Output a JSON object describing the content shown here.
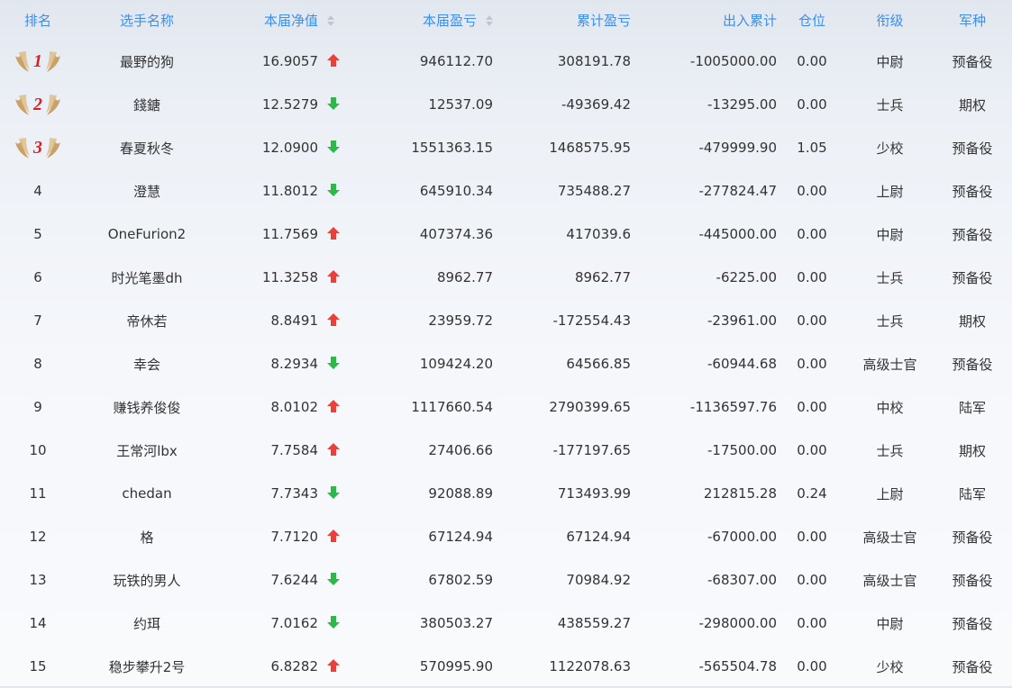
{
  "columns": {
    "rank": "排名",
    "name": "选手名称",
    "nav": "本届净值",
    "profit": "本届盈亏",
    "cumulative": "累计盈亏",
    "inout": "出入累计",
    "position": "仓位",
    "grade": "衔级",
    "branch": "军种"
  },
  "icons": {
    "sort": "sort-icon",
    "up": "arrow-up-icon",
    "down": "arrow-down-icon",
    "medal": "winged-medal-icon"
  },
  "colors": {
    "header_text": "#3d8ee6",
    "up": "#e8413a",
    "down": "#2fb84a",
    "medal_number": "#e21d1d",
    "wing": "#c9a26a"
  },
  "rows": [
    {
      "rank": "1",
      "name": "最野的狗",
      "nav": "16.9057",
      "trend": "up",
      "profit": "946112.70",
      "cumulative": "308191.78",
      "inout": "-1005000.00",
      "position": "0.00",
      "grade": "中尉",
      "branch": "预备役"
    },
    {
      "rank": "2",
      "name": "錢鎕",
      "nav": "12.5279",
      "trend": "down",
      "profit": "12537.09",
      "cumulative": "-49369.42",
      "inout": "-13295.00",
      "position": "0.00",
      "grade": "士兵",
      "branch": "期权"
    },
    {
      "rank": "3",
      "name": "春夏秋冬",
      "nav": "12.0900",
      "trend": "down",
      "profit": "1551363.15",
      "cumulative": "1468575.95",
      "inout": "-479999.90",
      "position": "1.05",
      "grade": "少校",
      "branch": "预备役"
    },
    {
      "rank": "4",
      "name": "澄慧",
      "nav": "11.8012",
      "trend": "down",
      "profit": "645910.34",
      "cumulative": "735488.27",
      "inout": "-277824.47",
      "position": "0.00",
      "grade": "上尉",
      "branch": "预备役"
    },
    {
      "rank": "5",
      "name": "OneFurion2",
      "nav": "11.7569",
      "trend": "up",
      "profit": "407374.36",
      "cumulative": "417039.6",
      "inout": "-445000.00",
      "position": "0.00",
      "grade": "中尉",
      "branch": "预备役"
    },
    {
      "rank": "6",
      "name": "时光笔墨dh",
      "nav": "11.3258",
      "trend": "up",
      "profit": "8962.77",
      "cumulative": "8962.77",
      "inout": "-6225.00",
      "position": "0.00",
      "grade": "士兵",
      "branch": "预备役"
    },
    {
      "rank": "7",
      "name": "帝休若",
      "nav": "8.8491",
      "trend": "up",
      "profit": "23959.72",
      "cumulative": "-172554.43",
      "inout": "-23961.00",
      "position": "0.00",
      "grade": "士兵",
      "branch": "期权"
    },
    {
      "rank": "8",
      "name": "幸会",
      "nav": "8.2934",
      "trend": "down",
      "profit": "109424.20",
      "cumulative": "64566.85",
      "inout": "-60944.68",
      "position": "0.00",
      "grade": "高级士官",
      "branch": "预备役"
    },
    {
      "rank": "9",
      "name": "赚钱养俊俊",
      "nav": "8.0102",
      "trend": "up",
      "profit": "1117660.54",
      "cumulative": "2790399.65",
      "inout": "-1136597.76",
      "position": "0.00",
      "grade": "中校",
      "branch": "陆军"
    },
    {
      "rank": "10",
      "name": "王常河lbx",
      "nav": "7.7584",
      "trend": "up",
      "profit": "27406.66",
      "cumulative": "-177197.65",
      "inout": "-17500.00",
      "position": "0.00",
      "grade": "士兵",
      "branch": "期权"
    },
    {
      "rank": "11",
      "name": "chedan",
      "nav": "7.7343",
      "trend": "down",
      "profit": "92088.89",
      "cumulative": "713493.99",
      "inout": "212815.28",
      "position": "0.24",
      "grade": "上尉",
      "branch": "陆军"
    },
    {
      "rank": "12",
      "name": "格",
      "nav": "7.7120",
      "trend": "up",
      "profit": "67124.94",
      "cumulative": "67124.94",
      "inout": "-67000.00",
      "position": "0.00",
      "grade": "高级士官",
      "branch": "预备役"
    },
    {
      "rank": "13",
      "name": "玩铁的男人",
      "nav": "7.6244",
      "trend": "down",
      "profit": "67802.59",
      "cumulative": "70984.92",
      "inout": "-68307.00",
      "position": "0.00",
      "grade": "高级士官",
      "branch": "预备役"
    },
    {
      "rank": "14",
      "name": "约珥",
      "nav": "7.0162",
      "trend": "down",
      "profit": "380503.27",
      "cumulative": "438559.27",
      "inout": "-298000.00",
      "position": "0.00",
      "grade": "中尉",
      "branch": "预备役"
    },
    {
      "rank": "15",
      "name": "稳步攀升2号",
      "nav": "6.8282",
      "trend": "up",
      "profit": "570995.90",
      "cumulative": "1122078.63",
      "inout": "-565504.78",
      "position": "0.00",
      "grade": "少校",
      "branch": "预备役"
    }
  ]
}
